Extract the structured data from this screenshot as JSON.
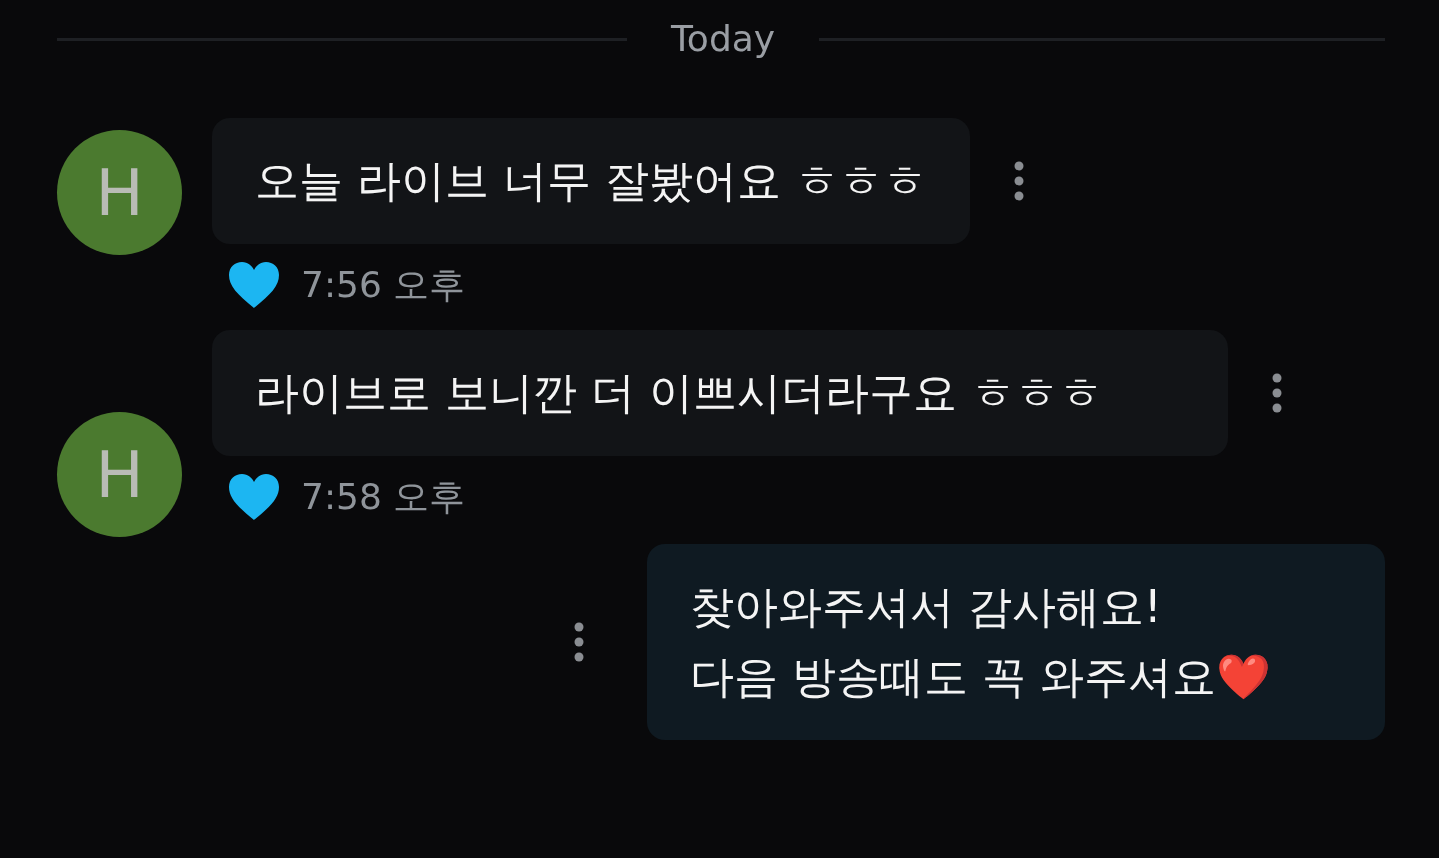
{
  "date_divider": "Today",
  "messages": [
    {
      "kind": "incoming",
      "avatar": "H",
      "text": "오늘 라이브 너무 잘봤어요 ㅎㅎㅎ",
      "liked": true,
      "time": "7:56 오후"
    },
    {
      "kind": "incoming",
      "avatar": "H",
      "text": "라이브로 보니깐 더 이쁘시더라구요 ㅎㅎㅎ",
      "liked": true,
      "time": "7:58 오후"
    },
    {
      "kind": "outgoing",
      "text": "찾아와주셔서 감사해요!\n다음 방송때도 꼭 와주셔요❤️"
    }
  ]
}
